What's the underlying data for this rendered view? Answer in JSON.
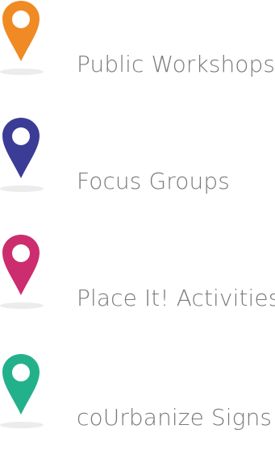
{
  "items": [
    {
      "label": "Public Workshops",
      "icon": "location-pin-icon",
      "color": "#f08a24"
    },
    {
      "label": "Focus Groups",
      "icon": "location-pin-icon",
      "color": "#3b3c96"
    },
    {
      "label": "Place It! Activities",
      "icon": "location-pin-icon",
      "color": "#cc2d6f"
    },
    {
      "label": "coUrbanize Signs",
      "icon": "location-pin-icon",
      "color": "#23b18c"
    }
  ]
}
